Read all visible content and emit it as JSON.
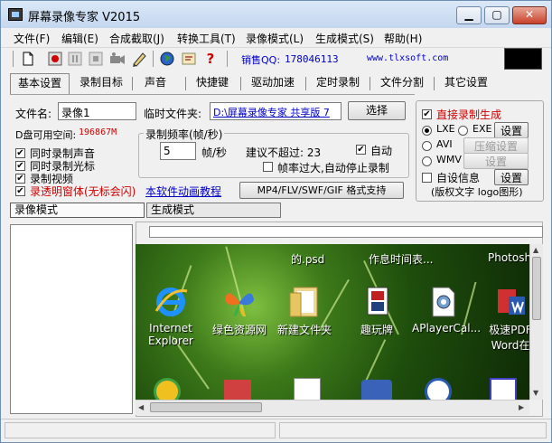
{
  "window": {
    "title": "屏幕录像专家 V2015",
    "min_symbol": "▁",
    "max_symbol": "▢",
    "close_symbol": "✕"
  },
  "menu": [
    "文件(F)",
    "编辑(E)",
    "合成截取(J)",
    "转换工具(T)",
    "录像模式(L)",
    "生成模式(S)",
    "帮助(H)"
  ],
  "toolbar": {
    "icons": [
      "new-file-icon",
      "record-icon",
      "pause-icon",
      "stop-icon",
      "camera-icon",
      "pen-icon",
      "globe-icon",
      "info-icon",
      "help-icon"
    ],
    "help_glyph": "?",
    "qq_label": "销售QQ:",
    "qq_number": "178046113",
    "website": "www.tlxsoft.com"
  },
  "tabs": [
    "基本设置",
    "录制目标",
    "声音",
    "快捷键",
    "驱动加速",
    "定时录制",
    "文件分割",
    "其它设置"
  ],
  "settings": {
    "filename_label": "文件名:",
    "filename_value": "录像1",
    "temp_folder_label": "临时文件夹:",
    "temp_folder_value": "D:\\屏幕录像专家 共享版 7",
    "select_button": "选择",
    "disk_space_label": "D盘可用空间:",
    "disk_space_value": "196867M",
    "options": [
      {
        "label": "同时录制声音",
        "checked": true,
        "check": "✔"
      },
      {
        "label": "同时录制光标",
        "checked": true,
        "check": "✔"
      },
      {
        "label": "录制视频",
        "checked": true,
        "check": "✔"
      },
      {
        "label": "录透明窗体(无标会闪)",
        "checked": true,
        "check": "✔"
      }
    ],
    "frame_rate_group": "录制频率(帧/秒)",
    "frame_rate_value": "5",
    "frame_rate_unit": "帧/秒",
    "suggest_label": "建议不超过: 23",
    "auto_label": "自动",
    "auto_check": "✔",
    "auto_stop_label": "帧率过大,自动停止录制",
    "tutorial_link": "本软件动画教程",
    "format_button": "MP4/FLV/SWF/GIF 格式支持"
  },
  "right_panel": {
    "direct_record_label": "直接录制生成",
    "direct_check": "✔",
    "format_options": [
      {
        "label": "LXE",
        "selected": true
      },
      {
        "label": "EXE",
        "selected": false
      },
      {
        "label": "AVI",
        "selected": false
      },
      {
        "label": "WMV",
        "selected": false
      }
    ],
    "setup_button": "设置",
    "compress_button": "压缩设置",
    "setup_disabled_button": "设置",
    "custom_info_label": "自设信息",
    "custom_info_button": "设置",
    "copyright_note": "(版权文字 logo图形)"
  },
  "lower": {
    "record_mode_tab": "录像模式",
    "generate_mode_tab": "生成模式"
  },
  "desktop_icons": [
    {
      "label_line1": "Internet",
      "label_line2": "Explorer",
      "icon": "ie-icon"
    },
    {
      "label_line1": "绿色资源网",
      "label_line2": "",
      "icon": "butterfly-shortcut-icon"
    },
    {
      "label_line1": "新建文件夹",
      "label_line2": "",
      "icon": "folder-icon"
    },
    {
      "label_line1": "趣玩牌",
      "label_line2": "",
      "icon": "cards-shortcut-icon"
    },
    {
      "label_line1": "APlayerCal...",
      "label_line2": "",
      "icon": "gear-file-icon"
    },
    {
      "label_line1": "极速PDF",
      "label_line2": "Word在",
      "icon": "pdf-word-icon"
    }
  ],
  "desktop_top_labels": [
    "的.psd",
    "作息时间表...",
    "Photosh"
  ],
  "scroll": {
    "up": "▲",
    "down": "▼",
    "left": "◀",
    "right": "▶"
  }
}
